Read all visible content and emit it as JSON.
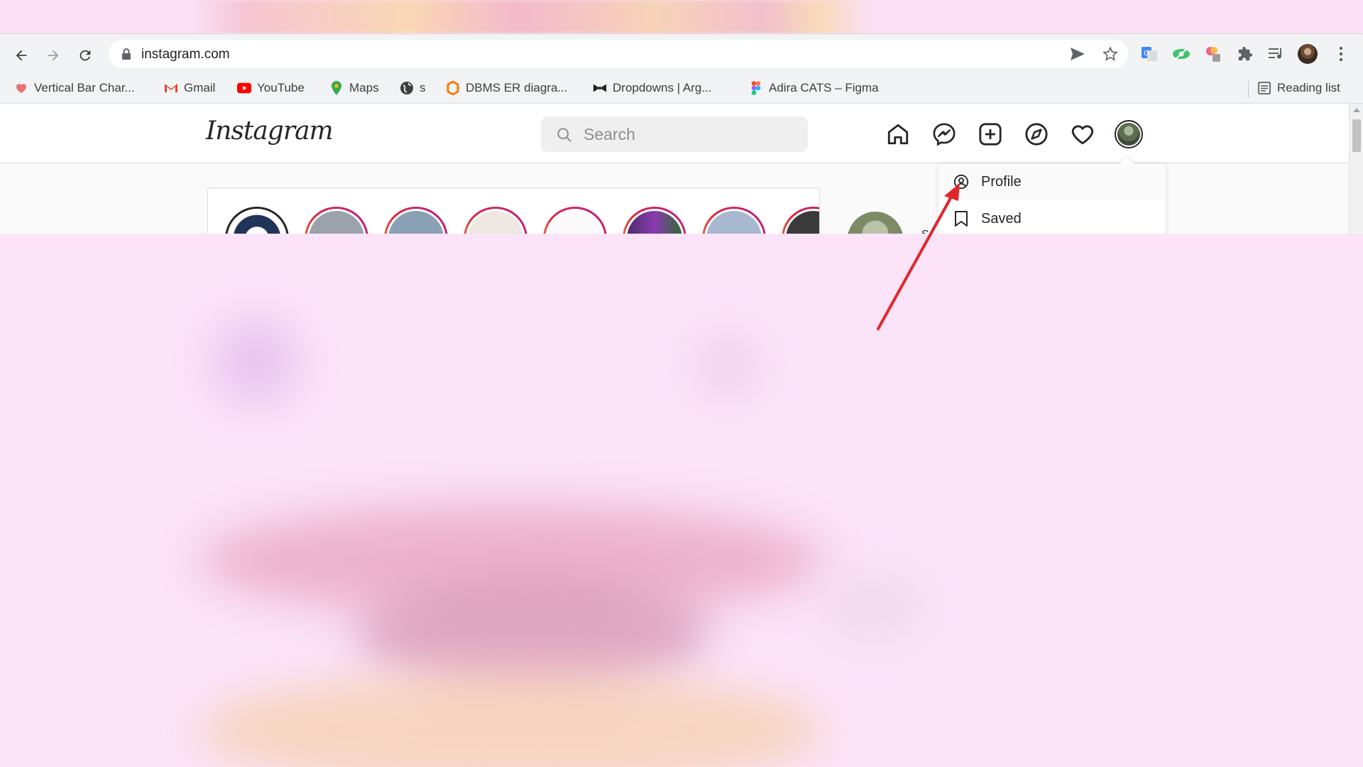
{
  "browser": {
    "url": "instagram.com",
    "bookmarks": [
      {
        "label": "Vertical Bar Char...",
        "icon": "chart-favicon"
      },
      {
        "label": "Gmail",
        "icon": "gmail-icon"
      },
      {
        "label": "YouTube",
        "icon": "youtube-icon"
      },
      {
        "label": "Maps",
        "icon": "maps-icon"
      },
      {
        "label": "s",
        "icon": "globe-icon"
      },
      {
        "label": "DBMS ER diagra...",
        "icon": "dbms-favicon"
      },
      {
        "label": "Dropdowns | Arg...",
        "icon": "bowtie-icon"
      },
      {
        "label": "Adira CATS – Figma",
        "icon": "figma-icon"
      }
    ],
    "reading_list": "Reading list"
  },
  "instagram": {
    "logo": "Instagram",
    "search_placeholder": "Search",
    "dropdown": {
      "items": [
        {
          "label": "Profile",
          "icon": "profile-icon"
        },
        {
          "label": "Saved",
          "icon": "bookmark-icon"
        }
      ]
    },
    "side_text": "S"
  },
  "colors": {
    "background_overlay": "#fbe3f8",
    "annotation_arrow": "#e0262b",
    "story_ring_gradient": [
      "#f09433",
      "#dc2743",
      "#bc1888"
    ]
  }
}
